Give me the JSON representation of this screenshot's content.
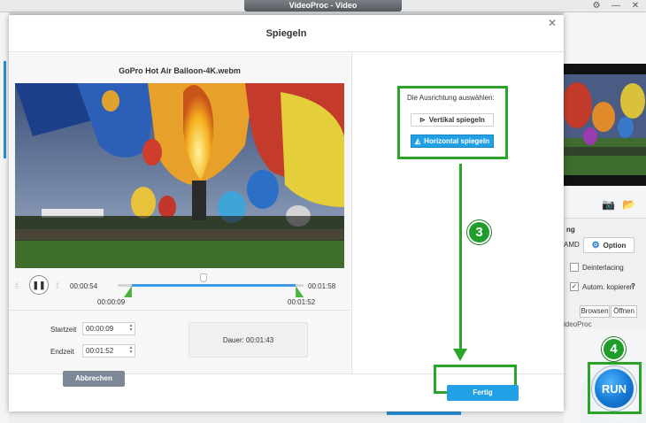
{
  "app": {
    "title": "VideoProc - Video",
    "window_controls": [
      "⚙",
      "—",
      "✕"
    ]
  },
  "dialog": {
    "title": "Spiegeln",
    "close_icon": "✕",
    "filename": "GoPro Hot Air Balloon-4K.webm",
    "player": {
      "pause_glyph": "❚❚",
      "current_time": "00:00:54",
      "total_time": "00:01:58",
      "trim_start_time": "00:00:09",
      "trim_end_time": "00:01:52",
      "playhead_fraction": 0.46,
      "trim_start_fraction": 0.076,
      "trim_end_fraction": 0.958
    },
    "trim": {
      "start_label": "Startzeit",
      "start_value": "00:00:09",
      "end_label": "Endzeit",
      "end_value": "00:01:52",
      "duration_text": "Dauer:  00:01:43"
    },
    "orientation": {
      "label": "Die Ausrichtung auswählen:",
      "vertical_label": "Vertikal spiegeln",
      "horizontal_label": "Horizontal spiegeln",
      "selected": "horizontal"
    },
    "footer": {
      "cancel_label": "Abbrechen",
      "done_label": "Fertig"
    }
  },
  "right_panel": {
    "hw_label_fragment": "ng",
    "amd_label": "AMD",
    "option_label": "Option",
    "deinterlacing_label": "Deinterlacing",
    "deinterlacing_checked": false,
    "auto_copy_label": "Autom. kopieren",
    "auto_copy_checked": true,
    "help_glyph": "?",
    "browse_label": "Browsen",
    "open_label": "Öffnen",
    "videoproc_fragment": "ideoProc",
    "run_label": "RUN"
  },
  "annotations": {
    "step3": "3",
    "step4": "4"
  },
  "colors": {
    "accent_blue": "#22a0e6",
    "highlight_green": "#2aa52a",
    "step_green": "#1f9d2a"
  }
}
